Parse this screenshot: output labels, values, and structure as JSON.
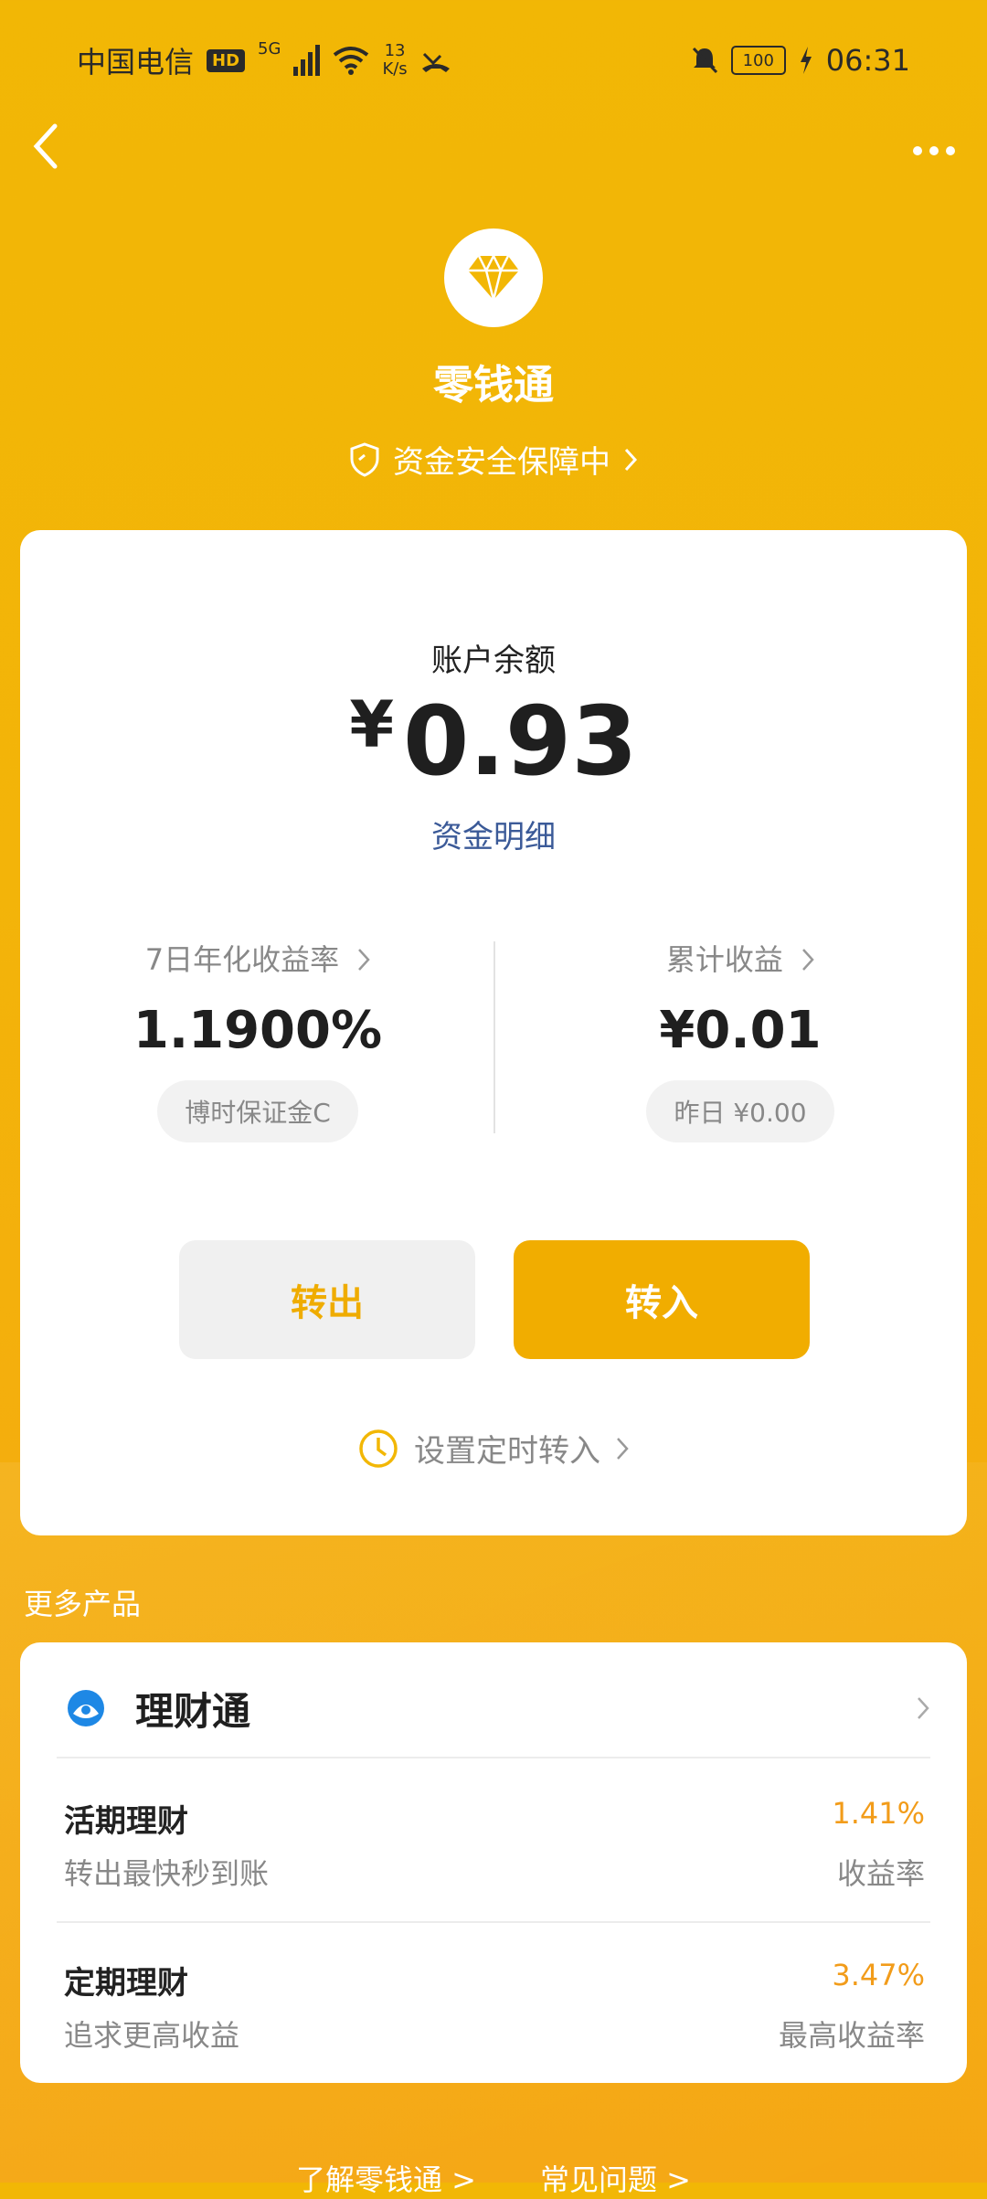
{
  "status_bar": {
    "carrier": "中国电信",
    "hd": "HD",
    "network": "5G",
    "speed_value": "13",
    "speed_unit": "K/s",
    "battery": "100",
    "time": "06:31"
  },
  "header": {
    "title": "零钱通",
    "safety_text": "资金安全保障中"
  },
  "balance": {
    "label": "账户余额",
    "currency": "¥",
    "amount": "0.93",
    "detail_link": "资金明细"
  },
  "stats": {
    "yield_label": "7日年化收益率",
    "yield_value": "1.1900%",
    "yield_tag": "博时保证金C",
    "income_label": "累计收益",
    "income_value": "¥0.01",
    "yesterday_tag": "昨日 ¥0.00"
  },
  "actions": {
    "transfer_out": "转出",
    "transfer_in": "转入",
    "schedule": "设置定时转入"
  },
  "more_products": {
    "section_title": "更多产品",
    "product_name": "理财通",
    "items": [
      {
        "title": "活期理财",
        "subtitle": "转出最快秒到账",
        "rate": "1.41%",
        "rate_label": "收益率"
      },
      {
        "title": "定期理财",
        "subtitle": "追求更高收益",
        "rate": "3.47%",
        "rate_label": "最高收益率"
      }
    ]
  },
  "footer": {
    "link1": "了解零钱通 >",
    "link2": "常见问题 >"
  },
  "colors": {
    "brand_yellow": "#f2b705",
    "accent_orange": "#f29c1a",
    "link_blue": "#3b5a98"
  }
}
